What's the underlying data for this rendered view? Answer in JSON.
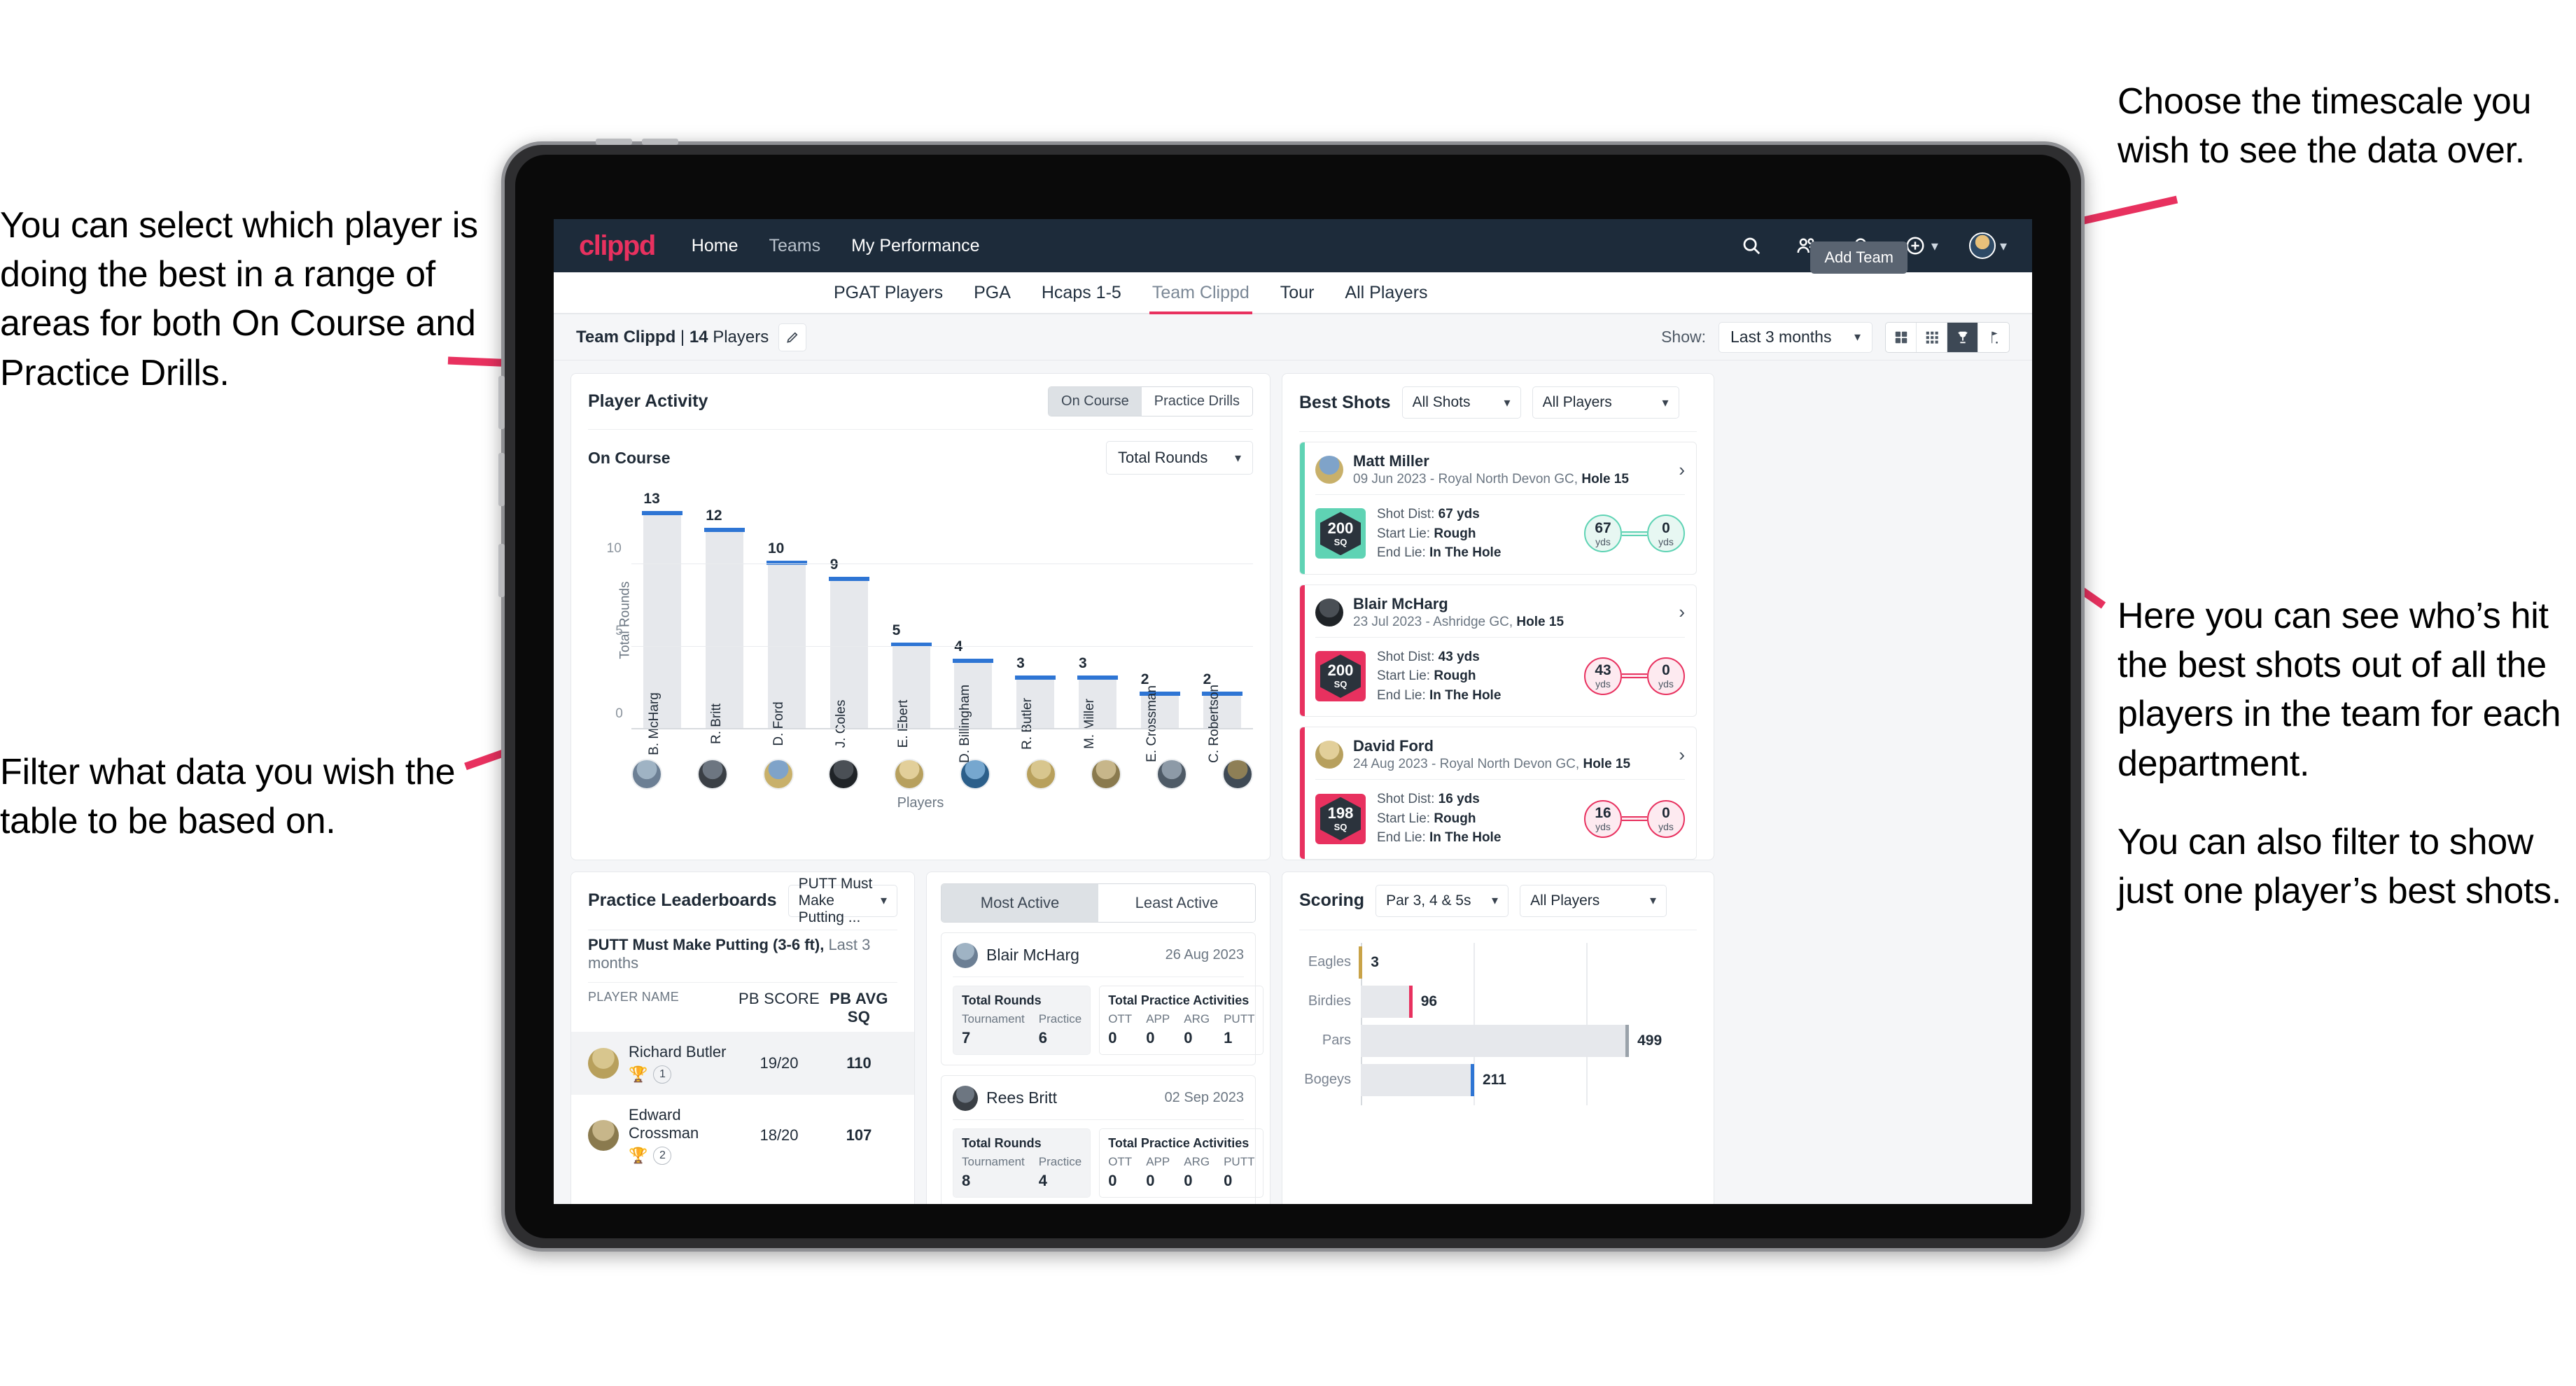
{
  "annotations": {
    "left_top": "You can select which player is doing the best in a range of areas for both On Course and Practice Drills.",
    "left_bottom": "Filter what data you wish the table to be based on.",
    "right_top": "Choose the timescale you wish to see the data over.",
    "right_middle": "Here you can see who’s hit the best shots out of all the players in the team for each department.",
    "right_bottom": "You can also filter to show just one player’s best shots."
  },
  "topnav": {
    "brand": "clippd",
    "links": [
      "Home",
      "Teams",
      "My Performance"
    ],
    "icons": [
      "search-icon",
      "people-icon",
      "bell-icon",
      "plus-circle-icon",
      "avatar"
    ]
  },
  "tabs": {
    "items": [
      "PGAT Players",
      "PGA",
      "Hcaps 1-5",
      "Team Clippd",
      "Tour",
      "All Players"
    ],
    "active": "Team Clippd",
    "tooltip": "Add Team"
  },
  "subheader": {
    "team_name": "Team Clippd",
    "player_count": "14",
    "players_word": "Players",
    "separator": " | ",
    "show_label": "Show:",
    "timescale": "Last 3 months",
    "view_modes": [
      "grid-large-icon",
      "grid-small-icon",
      "trophy-icon",
      "flag-icon"
    ],
    "active_view": "trophy-icon"
  },
  "player_activity": {
    "title": "Player Activity",
    "toggle": [
      "On Course",
      "Practice Drills"
    ],
    "toggle_active": "On Course",
    "section_label": "On Course",
    "metric": "Total Rounds"
  },
  "chart_data": {
    "type": "bar",
    "title": "On Course – Total Rounds",
    "xlabel": "Players",
    "ylabel": "Total Rounds",
    "ylim": [
      0,
      14
    ],
    "yticks": [
      0,
      5,
      10
    ],
    "grid": true,
    "categories": [
      "B. McHarg",
      "R. Britt",
      "D. Ford",
      "J. Coles",
      "E. Ebert",
      "D. Billingham",
      "R. Butler",
      "M. Miller",
      "E. Crossman",
      "C. Robertson"
    ],
    "values": [
      13,
      12,
      10,
      9,
      5,
      4,
      3,
      3,
      2,
      2
    ]
  },
  "best_shots": {
    "title": "Best Shots",
    "filter_shots": "All Shots",
    "filter_players": "All Players",
    "cards": [
      {
        "name": "Matt Miller",
        "meta_date": "09 Jun 2023",
        "meta_course": "Royal North Devon GC,",
        "meta_hole": "Hole 15",
        "sq": "200",
        "sq_unit": "SQ",
        "accent": "#5fd3b4",
        "shot_dist_label": "Shot Dist:",
        "shot_dist": "67 yds",
        "start_lie_label": "Start Lie:",
        "start_lie": "Rough",
        "end_lie_label": "End Lie:",
        "end_lie": "In The Hole",
        "from_val": "67",
        "from_unit": "yds",
        "to_val": "0",
        "to_unit": "yds"
      },
      {
        "name": "Blair McHarg",
        "meta_date": "23 Jul 2023",
        "meta_course": "Ashridge GC,",
        "meta_hole": "Hole 15",
        "sq": "200",
        "sq_unit": "SQ",
        "accent": "#e8315f",
        "shot_dist_label": "Shot Dist:",
        "shot_dist": "43 yds",
        "start_lie_label": "Start Lie:",
        "start_lie": "Rough",
        "end_lie_label": "End Lie:",
        "end_lie": "In The Hole",
        "from_val": "43",
        "from_unit": "yds",
        "to_val": "0",
        "to_unit": "yds"
      },
      {
        "name": "David Ford",
        "meta_date": "24 Aug 2023",
        "meta_course": "Royal North Devon GC,",
        "meta_hole": "Hole 15",
        "sq": "198",
        "sq_unit": "SQ",
        "accent": "#e8315f",
        "shot_dist_label": "Shot Dist:",
        "shot_dist": "16 yds",
        "start_lie_label": "Start Lie:",
        "start_lie": "Rough",
        "end_lie_label": "End Lie:",
        "end_lie": "In The Hole",
        "from_val": "16",
        "from_unit": "yds",
        "to_val": "0",
        "to_unit": "yds"
      }
    ]
  },
  "practice_leaderboards": {
    "title": "Practice Leaderboards",
    "drill_select": "PUTT Must Make Putting ...",
    "subtitle_bold": "PUTT Must Make Putting (3-6 ft),",
    "subtitle_rest": " Last 3 months",
    "columns": [
      "PLAYER NAME",
      "PB SCORE",
      "PB AVG SQ"
    ],
    "rows": [
      {
        "name": "Richard Butler",
        "rank": "1",
        "trophy": "gold",
        "pb_score": "19/20",
        "pb_avg_sq": "110"
      },
      {
        "name": "Edward Crossman",
        "rank": "2",
        "trophy": "silver",
        "pb_score": "18/20",
        "pb_avg_sq": "107"
      }
    ]
  },
  "activity": {
    "tabs": [
      "Most Active",
      "Least Active"
    ],
    "active_tab": "Most Active",
    "items": [
      {
        "name": "Blair McHarg",
        "date": "26 Aug 2023",
        "rounds_title": "Total Rounds",
        "rounds_keys": [
          "Tournament",
          "Practice"
        ],
        "rounds_vals": [
          "7",
          "6"
        ],
        "practice_title": "Total Practice Activities",
        "practice_keys": [
          "OTT",
          "APP",
          "ARG",
          "PUTT"
        ],
        "practice_vals": [
          "0",
          "0",
          "0",
          "1"
        ]
      },
      {
        "name": "Rees Britt",
        "date": "02 Sep 2023",
        "rounds_title": "Total Rounds",
        "rounds_keys": [
          "Tournament",
          "Practice"
        ],
        "rounds_vals": [
          "8",
          "4"
        ],
        "practice_title": "Total Practice Activities",
        "practice_keys": [
          "OTT",
          "APP",
          "ARG",
          "PUTT"
        ],
        "practice_vals": [
          "0",
          "0",
          "0",
          "0"
        ]
      }
    ]
  },
  "scoring": {
    "title": "Scoring",
    "filter_par": "Par 3, 4 & 5s",
    "filter_players": "All Players",
    "chart": {
      "type": "bar",
      "orientation": "horizontal",
      "categories": [
        "Eagles",
        "Birdies",
        "Pars",
        "Bogeys"
      ],
      "values": [
        3,
        96,
        499,
        211
      ],
      "colors": [
        "#c9a348",
        "#e8315f",
        "#9aa2aa",
        "#2e75d4"
      ],
      "xmax": 620,
      "grid": true
    }
  }
}
